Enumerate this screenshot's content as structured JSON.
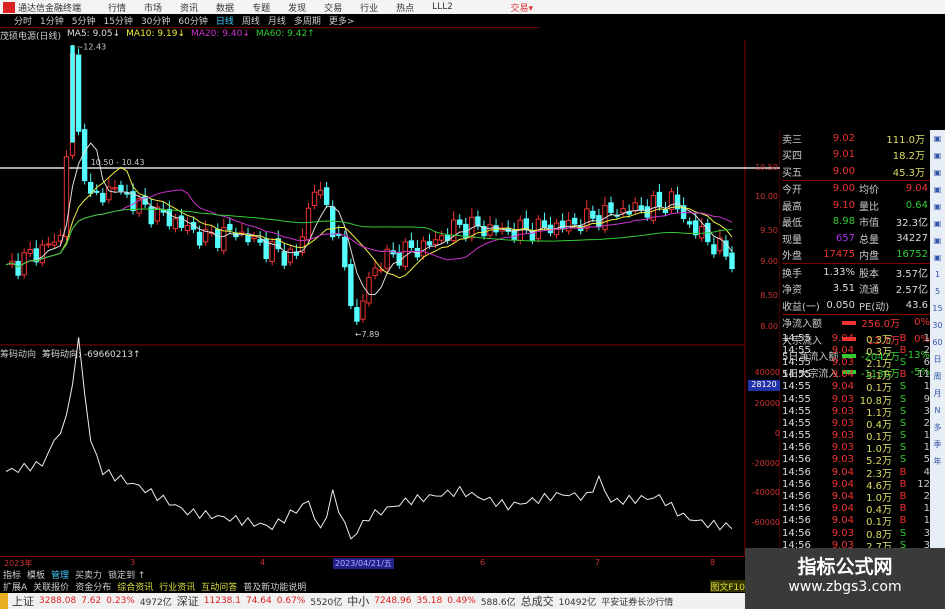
{
  "menu": {
    "app": "通达信金融终端",
    "items": [
      "行情",
      "市场",
      "资讯",
      "数据",
      "专题",
      "发现",
      "交易",
      "行业",
      "热点",
      "LLL2"
    ],
    "trade": "交易▾"
  },
  "toolbar": {
    "items": [
      "分时",
      "1分钟",
      "5分钟",
      "15分钟",
      "30分钟",
      "60分钟",
      "日线",
      "周线",
      "月线",
      "多周期",
      "更多>"
    ],
    "active": "日线"
  },
  "chart": {
    "title": "茂硕电源(日线)",
    "ma5": "MA5: 9.05↓",
    "ma10": "MA10: 9.19↓",
    "ma20": "MA20: 9.40↓",
    "ma60": "MA60: 9.42↑",
    "high_label": "~12.43",
    "line_label": "10.50 - 10.43",
    "low_label": "←7.89",
    "price_ticks": [
      "10.50",
      "10.00",
      "9.50",
      "9.00",
      "8.50",
      "8.00"
    ],
    "keypoints": [
      [
        0,
        8.9
      ],
      [
        9,
        9.4
      ],
      [
        11,
        12.2
      ],
      [
        12,
        11.0
      ],
      [
        14,
        10.0
      ],
      [
        18,
        10.2
      ],
      [
        22,
        9.9
      ],
      [
        27,
        9.7
      ],
      [
        33,
        9.4
      ],
      [
        38,
        9.5
      ],
      [
        44,
        9.2
      ],
      [
        48,
        9.1
      ],
      [
        51,
        10.2
      ],
      [
        53,
        9.9
      ],
      [
        55,
        9.3
      ],
      [
        57,
        8.5
      ],
      [
        58,
        8.0
      ],
      [
        60,
        8.8
      ],
      [
        63,
        9.1
      ],
      [
        70,
        9.3
      ],
      [
        75,
        9.6
      ],
      [
        83,
        9.5
      ],
      [
        93,
        9.6
      ],
      [
        100,
        9.8
      ],
      [
        108,
        9.9
      ],
      [
        110,
        10.0
      ],
      [
        113,
        9.6
      ],
      [
        117,
        9.3
      ],
      [
        120,
        9.05
      ]
    ]
  },
  "indicator": {
    "name": "筹码动向",
    "value_label": "筹码动向: -69660213↑",
    "ticks": [
      "40000",
      "20000",
      "0",
      "-20000",
      "-40000",
      "-60000"
    ],
    "cursor_value": "28120",
    "keypoints": [
      [
        0,
        -25000
      ],
      [
        6,
        -20000
      ],
      [
        10,
        10000
      ],
      [
        12,
        62000
      ],
      [
        14,
        -5000
      ],
      [
        16,
        -25000
      ],
      [
        22,
        -35000
      ],
      [
        30,
        -52000
      ],
      [
        38,
        -57000
      ],
      [
        44,
        -62000
      ],
      [
        50,
        -45000
      ],
      [
        52,
        -65000
      ],
      [
        54,
        -40000
      ],
      [
        57,
        -70000
      ],
      [
        60,
        -55000
      ],
      [
        66,
        -45000
      ],
      [
        75,
        -38000
      ],
      [
        83,
        -48000
      ],
      [
        92,
        -40000
      ],
      [
        96,
        -42000
      ],
      [
        98,
        -30000
      ],
      [
        100,
        -45000
      ],
      [
        108,
        -42000
      ],
      [
        112,
        -55000
      ],
      [
        116,
        -60000
      ],
      [
        120,
        -62000
      ]
    ]
  },
  "quote": {
    "top": [
      [
        "卖三",
        "9.02",
        "111.0万"
      ],
      [
        "买四",
        "9.01",
        "18.2万"
      ],
      [
        "买五",
        "9.00",
        "45.3万"
      ]
    ],
    "stats": [
      [
        "今开",
        "9.00",
        "均价",
        "9.04"
      ],
      [
        "最高",
        "9.10",
        "量比",
        "0.64"
      ],
      [
        "最低",
        "8.98",
        "市值",
        "32.3亿"
      ],
      [
        "现量",
        "657",
        "总量",
        "34227"
      ],
      [
        "外盘",
        "17475",
        "内盘",
        "16752"
      ],
      [
        "换手",
        "1.33%",
        "股本",
        "3.57亿"
      ],
      [
        "净资",
        "3.51",
        "流通",
        "2.57亿"
      ],
      [
        "收益(一)",
        "0.050",
        "PE(动)",
        "43.6"
      ]
    ],
    "flows": [
      [
        "净流入额",
        "256.0万",
        "0%"
      ],
      [
        "大宗流入",
        "12.7万",
        "0%"
      ],
      [
        "5日净流入额",
        "-2047万",
        "-13%"
      ],
      [
        "5日大宗流入",
        "-1130万",
        "-5%"
      ]
    ]
  },
  "ticks": [
    [
      "14:55",
      "9.04",
      "0.3万",
      "B",
      "1"
    ],
    [
      "14:55",
      "9.04",
      "0.3万",
      "B",
      "2"
    ],
    [
      "14:55",
      "9.03",
      "2.1万",
      "S",
      "6"
    ],
    [
      "14:55",
      "9.04",
      "3.1万",
      "B",
      "11"
    ],
    [
      "14:55",
      "9.04",
      "0.1万",
      "S",
      "1"
    ],
    [
      "14:55",
      "9.03",
      "10.8万",
      "S",
      "9"
    ],
    [
      "14:55",
      "9.03",
      "1.1万",
      "S",
      "3"
    ],
    [
      "14:55",
      "9.03",
      "0.4万",
      "S",
      "2"
    ],
    [
      "14:55",
      "9.03",
      "0.1万",
      "S",
      "1"
    ],
    [
      "14:56",
      "9.03",
      "1.0万",
      "S",
      "1"
    ],
    [
      "14:56",
      "9.03",
      "5.2万",
      "S",
      "5"
    ],
    [
      "14:56",
      "9.04",
      "2.3万",
      "B",
      "4"
    ],
    [
      "14:56",
      "9.04",
      "4.6万",
      "B",
      "12"
    ],
    [
      "14:56",
      "9.04",
      "1.0万",
      "B",
      "2"
    ],
    [
      "14:56",
      "9.04",
      "0.4万",
      "B",
      "1"
    ],
    [
      "14:56",
      "9.04",
      "0.1万",
      "B",
      "1"
    ],
    [
      "14:56",
      "9.03",
      "0.8万",
      "S",
      "3"
    ],
    [
      "14:56",
      "9.03",
      "2.7万",
      "S",
      "3"
    ]
  ],
  "side": [
    "1",
    "5",
    "15",
    "30",
    "60",
    "日",
    "周",
    "月",
    "N",
    "多",
    "季",
    "年"
  ],
  "dates": {
    "year": "2023年",
    "m3": "3",
    "m4": "4",
    "cursor": "2023/04/21/五",
    "m6": "6",
    "m7": "7",
    "m8": "8"
  },
  "tabs1": [
    "指标",
    "模板",
    "管理",
    "买卖力",
    "锁定到 ↑"
  ],
  "tabs2": [
    "扩展A",
    "关联报价",
    "资金分布",
    "综合资讯",
    "行业资讯",
    "互动问答",
    "普及新功能说明"
  ],
  "f10": "图文F10",
  "status": {
    "sh": "上证",
    "sh_v": "3288.08",
    "sh_c": "7.62",
    "sh_p": "0.23%",
    "sh_a": "4972亿",
    "sz": "深证",
    "sz_v": "11238.1",
    "sz_c": "74.64",
    "sz_p": "0.67%",
    "sz_a": "5520亿",
    "zx": "中小",
    "zx_v": "7248.96",
    "zx_c": "35.18",
    "zx_p": "0.49%",
    "zx_a": "588.6亿",
    "total": "总成交",
    "total_v": "10492亿",
    "broker": "平安证券长沙行情"
  },
  "watermark": {
    "title": "指标公式网",
    "url": "www.zbgs3.com"
  }
}
